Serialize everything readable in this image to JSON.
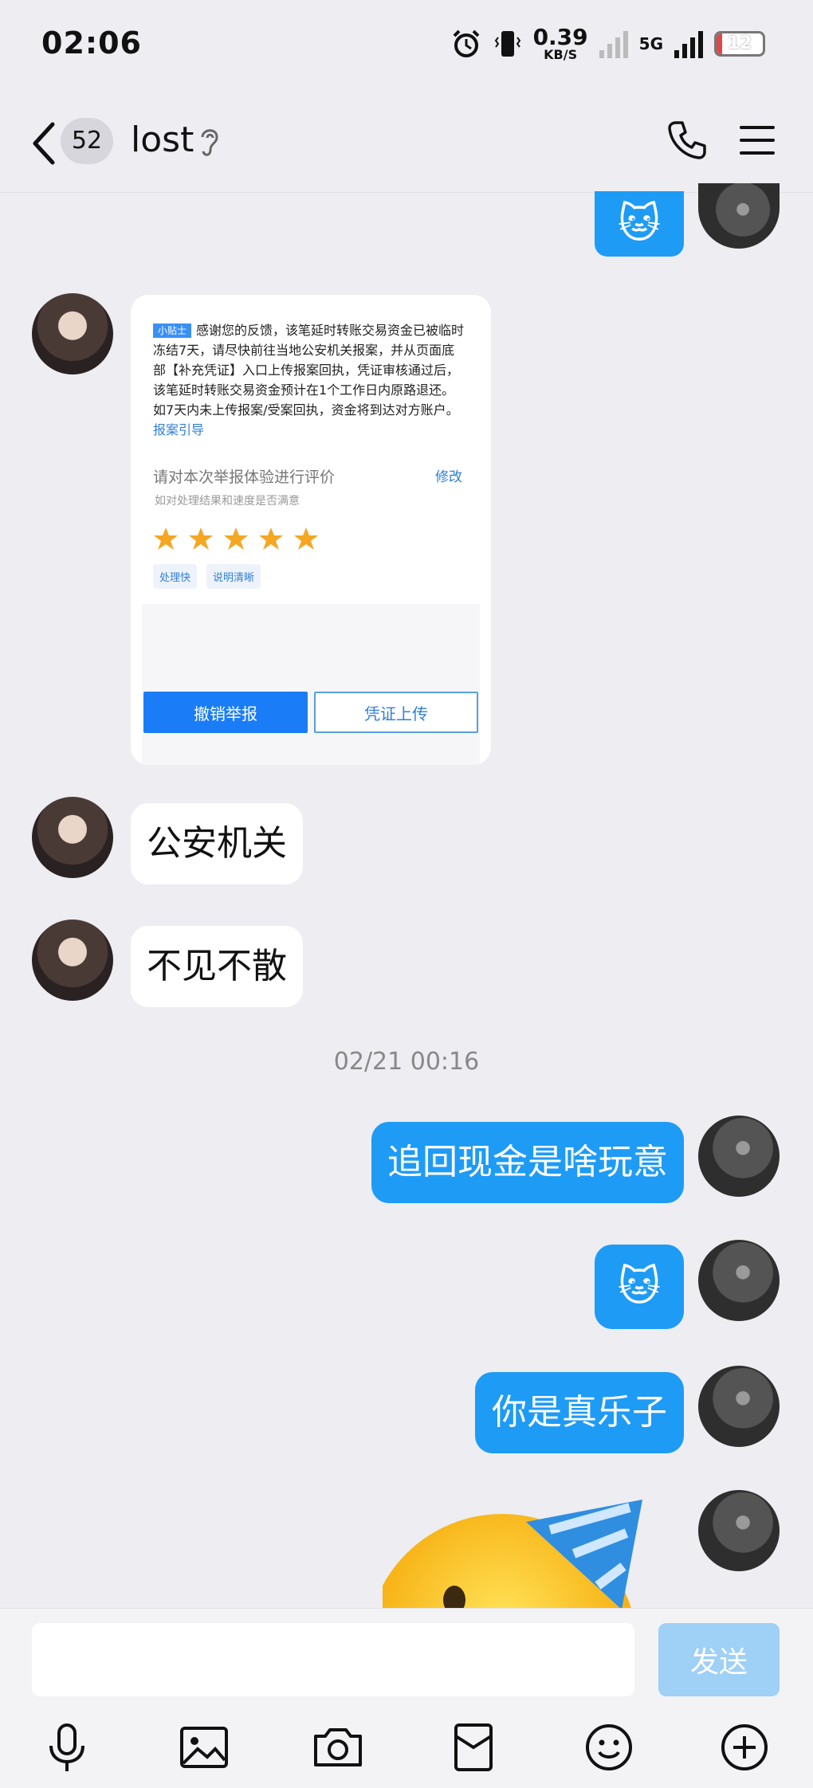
{
  "status_bar": {
    "time": "02:06",
    "speed_value": "0.39",
    "speed_unit": "KB/S",
    "network": "5G",
    "battery": "12"
  },
  "nav": {
    "unread_count": "52",
    "title": "lost"
  },
  "messages": {
    "sticker_top": "🐱",
    "card": {
      "tag": "小贴士",
      "notice": "感谢您的反馈，该笔延时转账交易资金已被临时冻结7天，请尽快前往当地公安机关报案，并从页面底部【补充凭证】入口上传报案回执，凭证审核通过后，该笔延时转账交易资金预计在1个工作日内原路退还。如7天内未上传报案/受案回执，资金将到达对方账户。",
      "link": "报案引导",
      "rate_title": "请对本次举报体验进行评价",
      "rate_edit": "修改",
      "rate_sub": "如对处理结果和速度是否满意",
      "stars": 5,
      "chips": [
        "处理快",
        "说明清晰"
      ],
      "cancel_label": "撤销举报",
      "upload_label": "凭证上传"
    },
    "in_1": "公安机关",
    "in_2": "不见不散",
    "timestamp": "02/21 00:16",
    "out_1": "追回现金是啥玩意",
    "sticker_mid": "🐱",
    "out_2": "你是真乐子"
  },
  "input": {
    "placeholder": "",
    "send_label": "发送"
  },
  "colors": {
    "accent": "#1e9bf5",
    "background": "#ededf2",
    "send_disabled": "#9fd0f6",
    "star": "#f5a623"
  }
}
